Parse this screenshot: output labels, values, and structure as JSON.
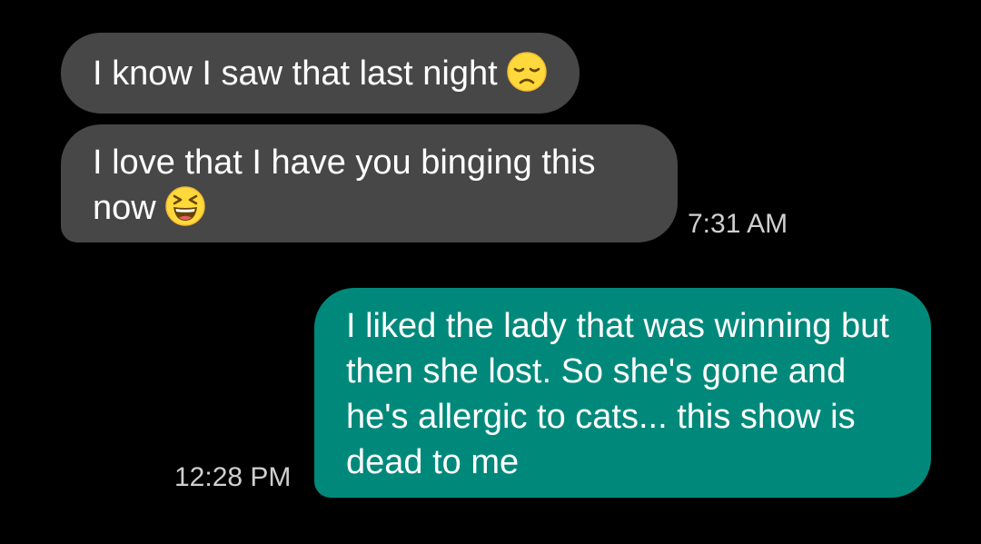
{
  "conversation": {
    "messages": [
      {
        "direction": "incoming",
        "text": "I know I saw that last night",
        "emoji": "disappointed-face-icon"
      },
      {
        "direction": "incoming",
        "text": "I love that I have you binging this now",
        "emoji": "grinning-squinting-face-icon",
        "timestamp": "7:31 AM"
      },
      {
        "direction": "outgoing",
        "text": "I liked the lady that was winning but then she lost. So she's gone and he's allergic to cats... this show is dead to me",
        "timestamp": "12:28 PM"
      }
    ]
  },
  "colors": {
    "background": "#000000",
    "incoming_bubble": "#474747",
    "outgoing_bubble": "#00897b",
    "message_text": "#ffffff",
    "timestamp_text": "#cfcfcf",
    "emoji_face": "#ffd93b"
  }
}
